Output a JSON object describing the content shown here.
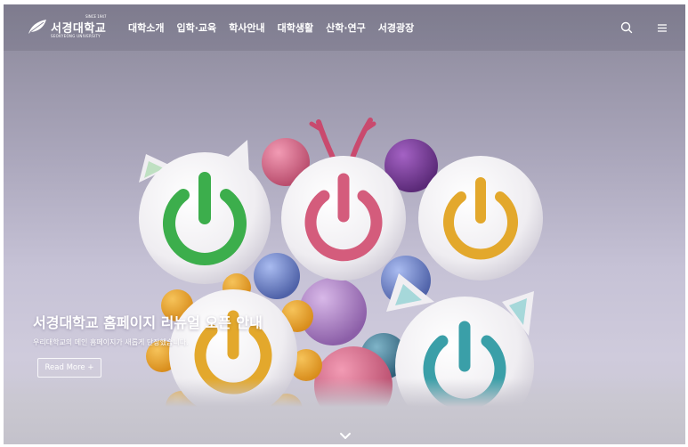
{
  "header": {
    "logo": {
      "name": "서경대학교",
      "subtitle": "SEOKYEONG UNIVERSITY",
      "since": "SINCE 1947"
    },
    "nav": [
      {
        "label": "대학소개"
      },
      {
        "label": "입학·교육"
      },
      {
        "label": "학사안내"
      },
      {
        "label": "대학생활"
      },
      {
        "label": "산학·연구"
      },
      {
        "label": "서경광장"
      }
    ],
    "search_icon": "search-icon",
    "menu_icon": "hamburger-menu-icon"
  },
  "hero": {
    "headline": "서경대학교 홈페이지 리뉴얼 오픈 안내",
    "subline": "우리대학교의 메인 홈페이지가 새롭게 단장했습니다.",
    "cta_label": "Read More +",
    "scroll_icon": "chevron-down-icon"
  },
  "colors": {
    "text": "#ffffff",
    "power_green": "#3cae4c",
    "power_pink": "#d45c7c",
    "power_yellow": "#e3a82c",
    "power_teal": "#3a9fa8",
    "ball_purple": "#7b3f9c",
    "ball_pink": "#d56e8c",
    "ball_blue": "#6c82c8"
  }
}
